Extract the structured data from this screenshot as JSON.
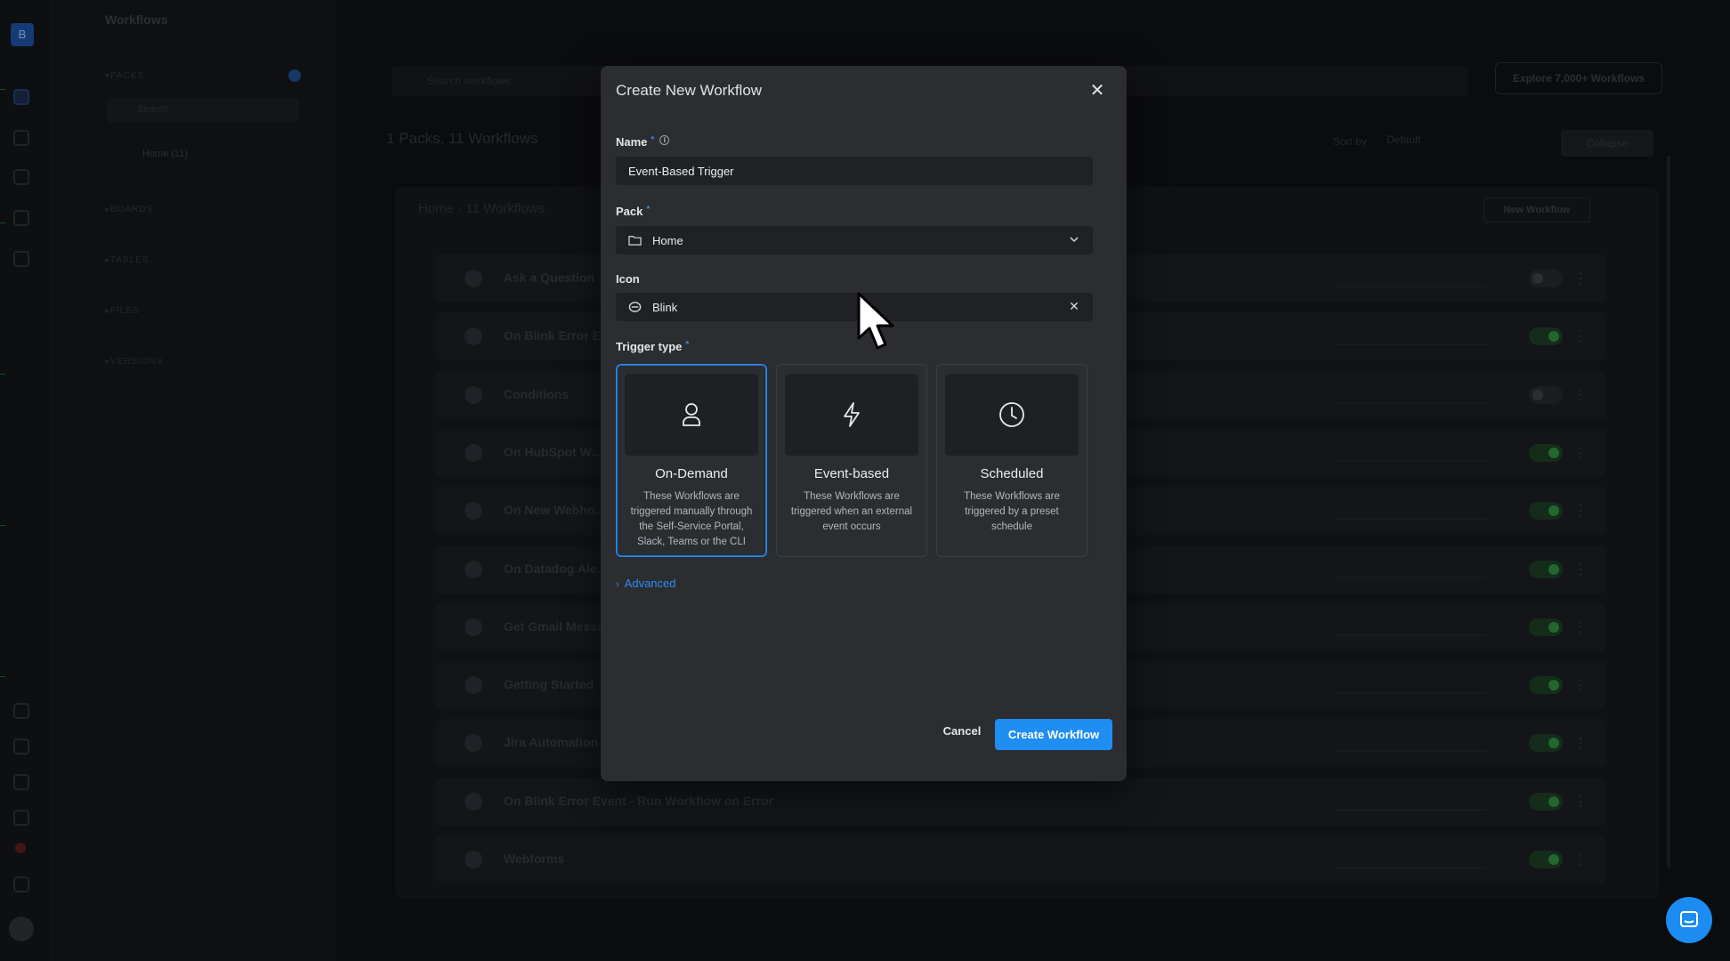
{
  "background": {
    "page_title": "Workflows",
    "sidebar": {
      "sections": [
        "PACKS",
        "BOARDS",
        "TABLES",
        "FILES",
        "VERSIONS"
      ],
      "search_placeholder": "Search",
      "home_item": "Home (11)"
    },
    "search_placeholder": "Search workflows",
    "explore_button": "Explore 7,000+ Workflows",
    "summary": "1 Packs, 11 Workflows",
    "sort_label": "Sort by",
    "sort_value": "Default",
    "collapse_button": "Collapse",
    "pack_header": "Home  ·  11 Workflows",
    "new_workflow_button": "New Workflow",
    "workflows": [
      {
        "name": "Ask a Question",
        "enabled": false
      },
      {
        "name": "On Blink Error E...",
        "enabled": true
      },
      {
        "name": "Conditions",
        "enabled": false
      },
      {
        "name": "On HubSpot W...",
        "enabled": true
      },
      {
        "name": "On New Webho...",
        "enabled": true
      },
      {
        "name": "On Datadog Ale...",
        "enabled": true
      },
      {
        "name": "Get Gmail Messa...",
        "enabled": true
      },
      {
        "name": "Getting Started",
        "enabled": true
      },
      {
        "name": "Jira Automation",
        "enabled": true
      },
      {
        "name": "On Blink Error Event - Run Workflow on Error",
        "enabled": true
      },
      {
        "name": "Webforms",
        "enabled": true
      }
    ]
  },
  "modal": {
    "title": "Create New Workflow",
    "close_icon": "close-icon",
    "name": {
      "label": "Name",
      "required": "*",
      "info": "i",
      "value": "Event-Based Trigger"
    },
    "pack": {
      "label": "Pack",
      "required": "*",
      "value": "Home",
      "icon": "folder-icon"
    },
    "icon": {
      "label": "Icon",
      "value": "Blink",
      "icon": "blink-logo-icon"
    },
    "trigger_type": {
      "label": "Trigger type",
      "required": "*",
      "selected": "on-demand",
      "options": [
        {
          "key": "on-demand",
          "title": "On-Demand",
          "icon": "person-icon",
          "desc": "These Workflows are triggered manually through the Self-Service Portal, Slack, Teams or the CLI"
        },
        {
          "key": "event-based",
          "title": "Event-based",
          "icon": "lightning-icon",
          "desc": "These Workflows are triggered when an external event occurs"
        },
        {
          "key": "scheduled",
          "title": "Scheduled",
          "icon": "clock-icon",
          "desc": "These Workflows are triggered by a preset schedule"
        }
      ]
    },
    "advanced_label": "Advanced",
    "cancel_label": "Cancel",
    "create_label": "Create Workflow"
  },
  "colors": {
    "accent": "#1f8df2",
    "modal_bg": "#2b2d31",
    "field_bg": "#1f2124",
    "toggle_on": "#2f8a3f"
  }
}
